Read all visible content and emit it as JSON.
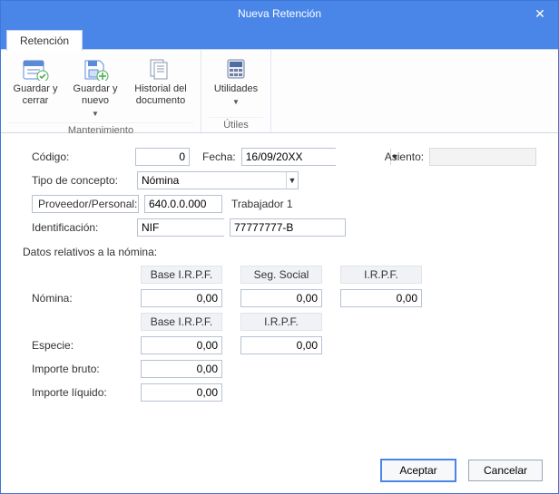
{
  "window": {
    "title": "Nueva Retención"
  },
  "tabs": {
    "retencion": "Retención"
  },
  "ribbon": {
    "groups": {
      "mantenimiento": {
        "label": "Mantenimiento",
        "save_close": "Guardar y cerrar",
        "save_new": "Guardar y nuevo",
        "history": "Historial del documento"
      },
      "utiles": {
        "label": "Útiles",
        "utilities": "Utilidades"
      }
    }
  },
  "form": {
    "codigo_label": "Código:",
    "codigo_value": "0",
    "fecha_label": "Fecha:",
    "fecha_value": "16/09/20XX",
    "asiento_label": "Asiento:",
    "tipo_concepto_label": "Tipo de concepto:",
    "tipo_concepto_value": "Nómina",
    "proveedor_label": "Proveedor/Personal:",
    "proveedor_code": "640.0.0.000",
    "proveedor_name": "Trabajador 1",
    "identificacion_label": "Identificación:",
    "id_tipo": "NIF",
    "id_valor": "77777777-B"
  },
  "nomina": {
    "section_title": "Datos relativos a la nómina:",
    "headers": {
      "base_irpf": "Base I.R.P.F.",
      "seg_social": "Seg. Social",
      "irpf": "I.R.P.F."
    },
    "rows": {
      "nomina_label": "Nómina:",
      "nomina_base": "0,00",
      "nomina_ss": "0,00",
      "nomina_irpf": "0,00",
      "especie_label": "Especie:",
      "especie_base": "0,00",
      "especie_irpf": "0,00",
      "importe_bruto_label": "Importe bruto:",
      "importe_bruto": "0,00",
      "importe_liquido_label": "Importe líquido:",
      "importe_liquido": "0,00"
    }
  },
  "footer": {
    "ok": "Aceptar",
    "cancel": "Cancelar"
  }
}
